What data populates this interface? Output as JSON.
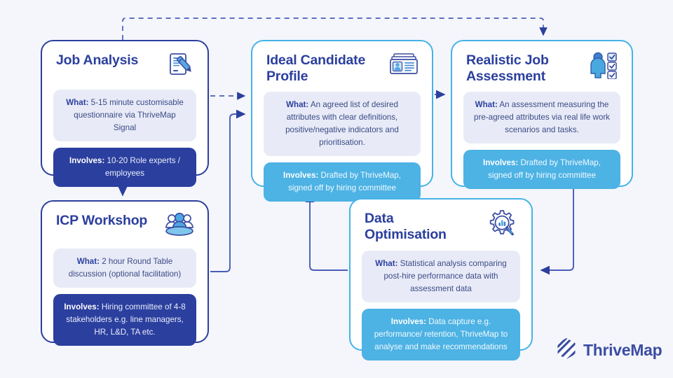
{
  "diagram": {
    "title": "ThriveMap hiring process flow",
    "background_color": "#f4f6fb",
    "accent_navy": "#2b3f9e",
    "accent_sky": "#46b2e8"
  },
  "cards": [
    {
      "id": "job-analysis",
      "title": "Job Analysis",
      "icon": "document-pencil-icon",
      "border": "navy",
      "what_label": "What:",
      "what_text": " 5-15 minute customisable questionnaire via ThriveMap Signal",
      "involves_label": "Involves:",
      "involves_text": " 10-20 Role experts / employees",
      "involves_style": "navy"
    },
    {
      "id": "icp-workshop",
      "title": "ICP Workshop",
      "icon": "people-group-icon",
      "border": "navy",
      "what_label": "What:",
      "what_text": " 2 hour Round Table discussion (optional facilitation)",
      "involves_label": "Involves:",
      "involves_text": " Hiring committee of 4-8 stakeholders e.g. line managers, HR, L&D, TA etc.",
      "involves_style": "navy"
    },
    {
      "id": "ideal-candidate",
      "title": "Ideal Candidate\nProfile",
      "icon": "id-card-icon",
      "border": "sky",
      "what_label": "What:",
      "what_text": " An agreed list of desired attributes with clear definitions, positive/negative indicators and prioritisation.",
      "involves_label": "Involves:",
      "involves_text": " Drafted by ThriveMap, signed off by hiring committee",
      "involves_style": "sky"
    },
    {
      "id": "realistic-job",
      "title": "Realistic Job\nAssessment",
      "icon": "person-checklist-icon",
      "border": "sky",
      "what_label": "What:",
      "what_text": " An assessment measuring the pre-agreed attributes via real life work scenarios and tasks.",
      "involves_label": "Involves:",
      "involves_text": " Drafted by ThriveMap, signed off by hiring committee",
      "involves_style": "sky"
    },
    {
      "id": "data-optimisation",
      "title": "Data\nOptimisation",
      "icon": "gear-chart-magnifier-icon",
      "border": "sky",
      "what_label": "What:",
      "what_text": " Statistical analysis comparing post-hire performance data with assessment data",
      "involves_label": "Involves:",
      "involves_text": " Data capture e.g. performance/ retention, ThriveMap to analyse and make recommendations",
      "involves_style": "sky"
    }
  ],
  "connections": [
    {
      "from": "job-analysis",
      "to": "ideal-candidate",
      "style": "dashed"
    },
    {
      "from": "job-analysis",
      "to": "icp-workshop",
      "style": "solid"
    },
    {
      "from": "icp-workshop",
      "to": "ideal-candidate",
      "style": "solid"
    },
    {
      "from": "ideal-candidate",
      "to": "realistic-job",
      "style": "solid"
    },
    {
      "from": "realistic-job",
      "to": "data-optimisation",
      "style": "solid"
    },
    {
      "from": "data-optimisation",
      "to": "ideal-candidate",
      "style": "solid"
    },
    {
      "from": "job-analysis",
      "to": "realistic-job",
      "style": "dashed"
    }
  ],
  "logo": {
    "wordmark": "ThriveMap",
    "mark": "thrivemap-hex-logo-icon",
    "color": "#3c4da3"
  }
}
